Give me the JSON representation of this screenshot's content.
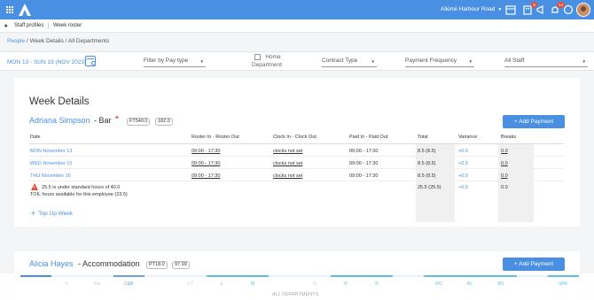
{
  "topbar": {
    "venue": "Alkimii Harbour Road",
    "notifications": [
      {
        "icon": "calendar-icon",
        "badge": ""
      },
      {
        "icon": "building-icon",
        "badge": "8"
      },
      {
        "icon": "megaphone-icon",
        "badge": ""
      },
      {
        "icon": "bell-icon",
        "badge": "14"
      },
      {
        "icon": "chat-icon",
        "badge": ""
      }
    ]
  },
  "tabs": [
    "Staff profiles",
    "Week roster"
  ],
  "breadcrumb": {
    "link": "People",
    "rest": " / Week Details / All Departments"
  },
  "filters": {
    "date_range": "MON 13 - SUN 19 (NOV 2023)",
    "pay_type": "Filter by Pay type",
    "home_department": "Home",
    "home_department2": "Department",
    "contract_type": "Contract Type",
    "payment_frequency": "Payment Frequency",
    "staff": "All Staff"
  },
  "week_title": "Week Details",
  "employee": {
    "name": "Adriana Simpson",
    "role": "- Bar",
    "tags": [
      "FT540.0",
      "182.0"
    ],
    "add_payment": "+ Add Payment"
  },
  "columns": [
    "Date",
    "Roster In - Roster Out",
    "Clock In - Clock Out",
    "Paid In - Paid Out",
    "Total",
    "Variance",
    "Breaks"
  ],
  "rows": [
    {
      "date": "MON November 13",
      "roster": "09:00 - 17:30",
      "clock": "clocks not set",
      "paid": "09:00 - 17:30",
      "total": "8.5 (8.5)",
      "variance": "+0.0",
      "breaks": "0.0"
    },
    {
      "date": "WED November 15",
      "roster": "09:00 - 17:30",
      "clock": "clocks not set",
      "paid": "09:00 - 17:30",
      "total": "8.5 (8.5)",
      "variance": "+0.0",
      "breaks": "0.0"
    },
    {
      "date": "THU November 16",
      "roster": "09:00 - 17:30",
      "clock": "clocks not set",
      "paid": "09:00 - 17:30",
      "total": "8.5 (8.5)",
      "variance": "+0.0",
      "breaks": "0.0"
    }
  ],
  "summary": {
    "warning": "25.5 is under standard hours of 40.0",
    "toil": "TOIL hours available for this employee (23.5)",
    "total": "25.5 (25.5)",
    "variance": "+0.0",
    "breaks": "0.0"
  },
  "top_up": "Top Up Week",
  "employee2": {
    "name": "Alicia Hayes",
    "role": "- Accommodation",
    "tags": [
      "PT18.0",
      "97.99"
    ],
    "add_payment": "+ Add Payment"
  },
  "departments": [
    {
      "label": "",
      "color": "#4a90e2"
    },
    {
      "label": "A",
      "color": "#e8f0fb"
    },
    {
      "label": "Bar",
      "color": "#e8f0fb"
    },
    {
      "label": "C&B",
      "color": "#6aa0de"
    },
    {
      "label": "",
      "color": "#e8f0fb"
    },
    {
      "label": "KIT",
      "color": "#e8f0fb"
    },
    {
      "label": "L",
      "color": "#5bc0de"
    },
    {
      "label": "M",
      "color": "#5bc0de"
    },
    {
      "label": "",
      "color": "#e8f0fb"
    },
    {
      "label": "N",
      "color": "#e8f0fb"
    },
    {
      "label": "R",
      "color": "#5bc0de"
    },
    {
      "label": "R",
      "color": "#5bc0de"
    },
    {
      "label": "",
      "color": "#e8f0fb"
    },
    {
      "label": "RO",
      "color": "#5bc0de"
    },
    {
      "label": "RL",
      "color": "#5bc0de"
    },
    {
      "label": "RS",
      "color": "#5bc0de"
    },
    {
      "label": "",
      "color": "#e8f0fb"
    },
    {
      "label": "SPA",
      "color": "#5bc0de"
    }
  ],
  "all_departments": "ALL DEPARTMENTS"
}
